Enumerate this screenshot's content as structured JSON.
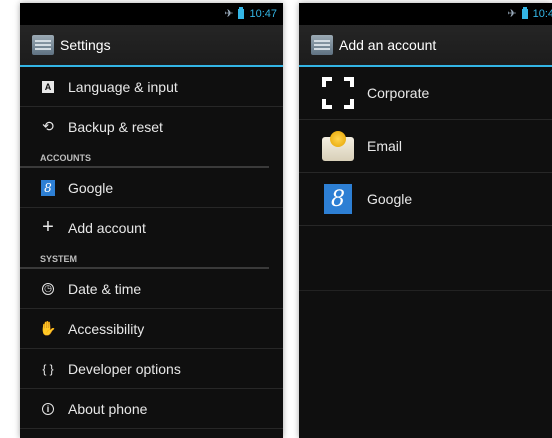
{
  "left": {
    "status": {
      "time": "10:47"
    },
    "title": "Settings",
    "items_top": [
      {
        "label": "Language & input",
        "icon": "keyboard-a-icon"
      },
      {
        "label": "Backup & reset",
        "icon": "backup-icon"
      }
    ],
    "accounts_header": "ACCOUNTS",
    "accounts_items": [
      {
        "label": "Google",
        "icon": "google-icon"
      },
      {
        "label": "Add account",
        "icon": "plus-icon"
      }
    ],
    "system_header": "SYSTEM",
    "system_items": [
      {
        "label": "Date & time",
        "icon": "clock-icon"
      },
      {
        "label": "Accessibility",
        "icon": "hand-icon"
      },
      {
        "label": "Developer options",
        "icon": "braces-icon"
      },
      {
        "label": "About phone",
        "icon": "info-icon"
      }
    ]
  },
  "right": {
    "status": {
      "time": "10:4"
    },
    "title": "Add an account",
    "accounts": [
      {
        "label": "Corporate",
        "icon": "corporate-icon"
      },
      {
        "label": "Email",
        "icon": "email-icon"
      },
      {
        "label": "Google",
        "icon": "google-icon"
      }
    ]
  },
  "colors": {
    "accent": "#33b5e5",
    "background": "#0f0f0f",
    "text": "#e8e8e8",
    "google_blue": "#2d7fd4"
  }
}
